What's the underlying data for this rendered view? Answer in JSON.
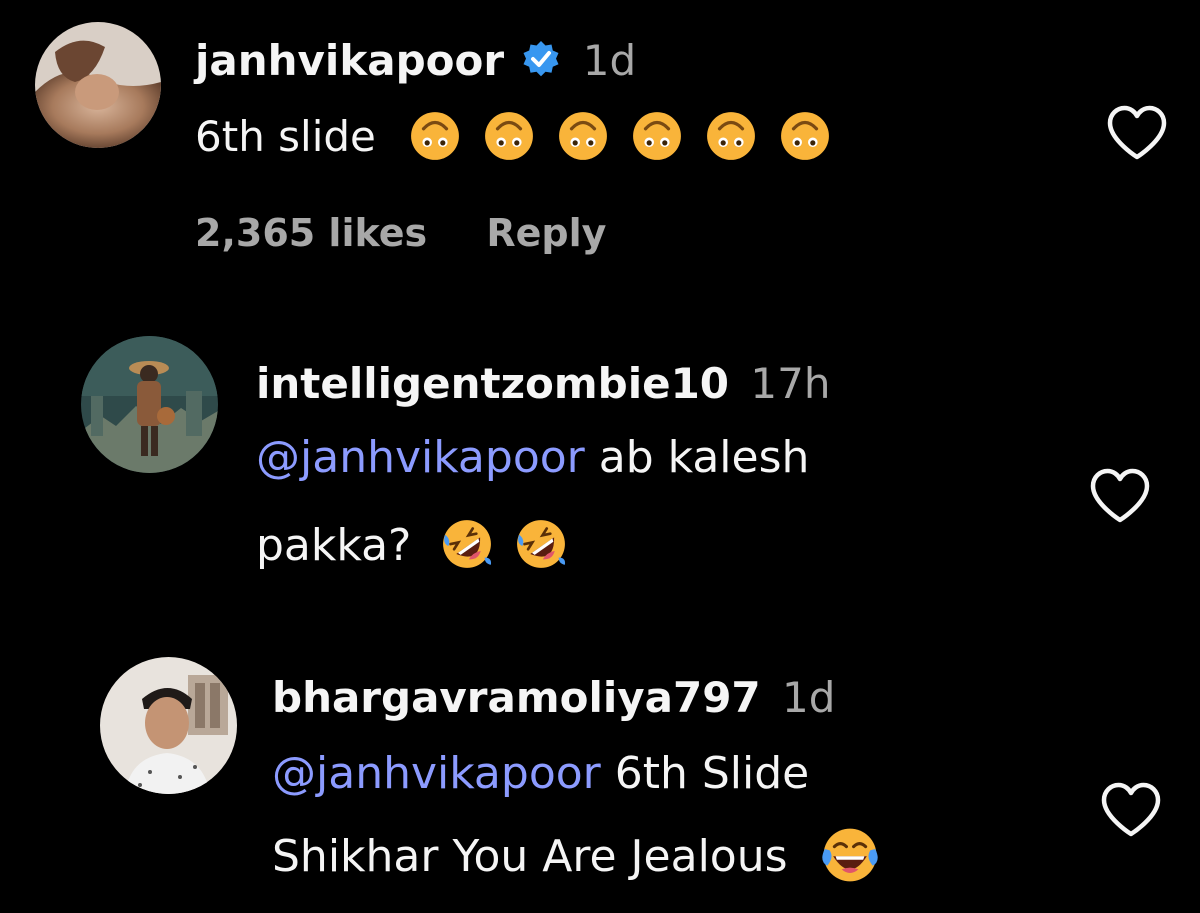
{
  "comments": [
    {
      "username": "janhvikapoor",
      "verified": true,
      "time": "1d",
      "mention": "",
      "text": "6th slide",
      "text_line2": "",
      "emoji": "upside-down-face",
      "emoji_count": 6,
      "likes": "2,365 likes",
      "reply": "Reply"
    },
    {
      "username": "intelligentzombie10",
      "verified": false,
      "time": "17h",
      "mention": "@janhvikapoor",
      "text": " ab kalesh",
      "text_line2": "pakka?",
      "emoji": "rolling-on-floor-laughing",
      "emoji_count": 2
    },
    {
      "username": "bhargavramoliya797",
      "verified": false,
      "time": "1d",
      "mention": "@janhvikapoor",
      "text": " 6th Slide",
      "text_line2": "Shikhar You Are Jealous",
      "emoji": "face-with-tears-of-joy",
      "emoji_count": 1
    }
  ],
  "colors": {
    "background": "#000000",
    "text": "#f5f5f5",
    "secondary": "#a8a8a8",
    "mention": "#8c9bff",
    "verified": "#3897f0",
    "emoji": "#f9b43a"
  },
  "icons": {
    "like": "heart-outline-icon",
    "verified": "verified-badge-icon"
  }
}
